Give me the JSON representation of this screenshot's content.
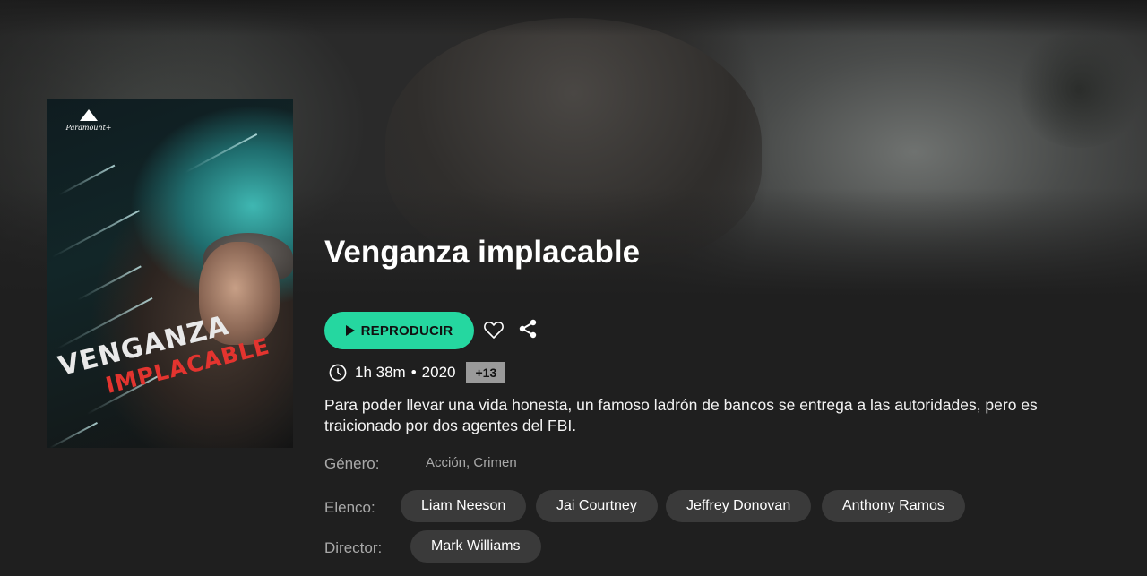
{
  "poster": {
    "brand": "Paramount+",
    "title_line1": "VENGANZA",
    "title_line2": "IMPLACABLE"
  },
  "movie": {
    "title": "Venganza implacable",
    "play_label": "REPRODUCIR",
    "duration": "1h 38m",
    "separator": "•",
    "year": "2020",
    "rating": "+13",
    "description": "Para poder llevar una vida honesta, un famoso ladrón de bancos se entrega a las autoridades, pero es traicionado por dos agentes del FBI."
  },
  "details": {
    "genre_label": "Género:",
    "genre_value": "Acción, Crimen",
    "cast_label": "Elenco:",
    "cast": [
      "Liam Neeson",
      "Jai Courtney",
      "Jeffrey Donovan",
      "Anthony Ramos"
    ],
    "director_label": "Director:",
    "directors": [
      "Mark Williams"
    ]
  },
  "colors": {
    "accent": "#25d7a0",
    "background": "#1f1f1f",
    "chip": "#3a3a3a",
    "rating_bg": "#9a9a9a"
  },
  "icons": {
    "favorite": "heart-icon",
    "share": "share-icon",
    "duration": "clock-icon",
    "play": "play-icon"
  }
}
